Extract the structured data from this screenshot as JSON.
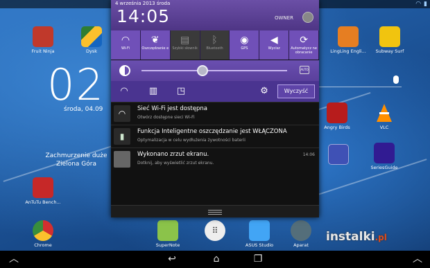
{
  "shade": {
    "date": "4 września 2013 środa",
    "time": "14:05",
    "owner": "OWNER",
    "toggles": [
      {
        "label": "Wi-Fi",
        "icon": "wifi-icon",
        "on": true
      },
      {
        "label": "Oszczędzanie e",
        "icon": "leaf-battery-icon",
        "on": true
      },
      {
        "label": "Szybki słownik",
        "icon": "book-icon",
        "on": false
      },
      {
        "label": "Bluetooth",
        "icon": "bluetooth-icon",
        "on": false
      },
      {
        "label": "GPS",
        "icon": "gps-icon",
        "on": true
      },
      {
        "label": "Wycisz",
        "icon": "speaker-icon",
        "on": true
      },
      {
        "label": "Automatycz ne obracanie",
        "icon": "rotate-icon",
        "on": true
      }
    ],
    "brightness_level": 0.42,
    "brightness_auto_label": "AUTO",
    "clear_button": "Wyczyść",
    "notifications": [
      {
        "title": "Sieć Wi-Fi jest dostępna",
        "subtitle": "Otwórz dostępne sieci Wi-Fi",
        "time": "",
        "icon": "wifi-icon"
      },
      {
        "title": "Funkcja Inteligentne oszczędzanie jest WŁĄCZONA",
        "subtitle": "Optymalizacja w celu wydłużenia żywotności baterii",
        "time": "",
        "icon": "battery-leaf-icon"
      },
      {
        "title": "Wykonano zrzut ekranu.",
        "subtitle": "Dotknij, aby wyświetlić zrzut ekranu.",
        "time": "14:06",
        "icon": "screenshot-thumbnail"
      }
    ]
  },
  "home": {
    "clock": "02",
    "date": "środa, 04.09",
    "weather_line1": "Zachmurzenie duże",
    "weather_line2": "Zielona Góra",
    "apps": [
      {
        "label": "Fruit Ninja",
        "color": "#c0392b"
      },
      {
        "label": "Dysk",
        "color": "#2e7d32"
      },
      {
        "label": "LingLing Engli...",
        "color": "#e67e22"
      },
      {
        "label": "Subway Surf",
        "color": "#f1c40f"
      },
      {
        "label": "Angry Birds",
        "color": "#b71c1c"
      },
      {
        "label": "VLC",
        "color": "#ff8f00"
      },
      {
        "label": "SeriesGuide",
        "color": "#311b92"
      },
      {
        "label": "AnTuTu Bench...",
        "color": "#c62828"
      },
      {
        "label": "Chrome",
        "color": "#e0e0e0"
      },
      {
        "label": "SuperNote",
        "color": "#8bc34a"
      },
      {
        "label": "ASUS Studio",
        "color": "#42a5f5"
      },
      {
        "label": "Aparat",
        "color": "#546e7a"
      }
    ]
  },
  "watermark": "instalki",
  "watermark_suffix": ".pl"
}
